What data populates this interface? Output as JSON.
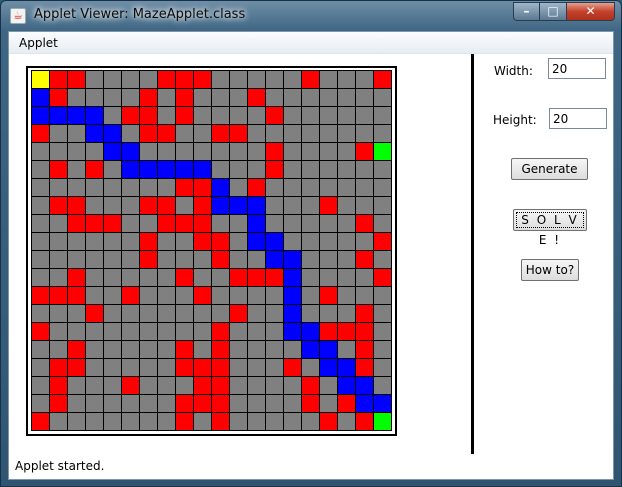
{
  "window": {
    "title": "Applet Viewer: MazeApplet.class",
    "icon": "java-icon"
  },
  "menubar": {
    "items": [
      "Applet"
    ]
  },
  "controls": {
    "width_label": "Width:",
    "width_value": "20",
    "height_label": "Height:",
    "height_value": "20",
    "generate_label": "Generate",
    "solve_label": "S O L V E !",
    "howto_label": "How to?"
  },
  "status": "Applet started.",
  "maze": {
    "rows": 20,
    "cols": 20,
    "colors": {
      "wall": "#ff0000",
      "open": "#808080",
      "path": "#0000ff",
      "start": "#ffff00",
      "end": "#00ff00",
      "grid": "#000000"
    },
    "legend": "Y=start, E=end, B=solution path, R=wall, G=open",
    "grid": [
      "YRRGGGGRRRGGGGGRGGGR",
      "BRGGGGRGRGGGRGGGGGGG",
      "BBBBGRRGRGGGGRGGGGGG",
      "RGGBBGRRGGRRGGGGGGGG",
      "GGGGBBGGGGGGGRGGGGRE",
      "GRGRGBBBBBGGGRGGGGGG",
      "GGGGGGGGRRBGRGGGGGGG",
      "GRRGGGRRGRBBBGGGRGGG",
      "GGRRRGGRRRGGBGGGGGRG",
      "GGGGGGRGGRRGBBGGGGGR",
      "GGGGGGRGGGRGGBBGGGRG",
      "GGRGGGGGRGGRRRBGGGGR",
      "RRRGGRGGGRGGGGBGRGGG",
      "GGGRGGGGGGGRGGBGGGRG",
      "RGGGGGGGGGRGGGBBRRRG",
      "GGRGGGGGRGRGGGGBBGRG",
      "GRRGGGGGRRRGGGRGBBRG",
      "GRGGGRGGGRRGGGGRGBBG",
      "GRGGGGGGRRRGGGGRGRBB",
      "RGGGGGGGRGRGGGGGRGRE"
    ]
  }
}
